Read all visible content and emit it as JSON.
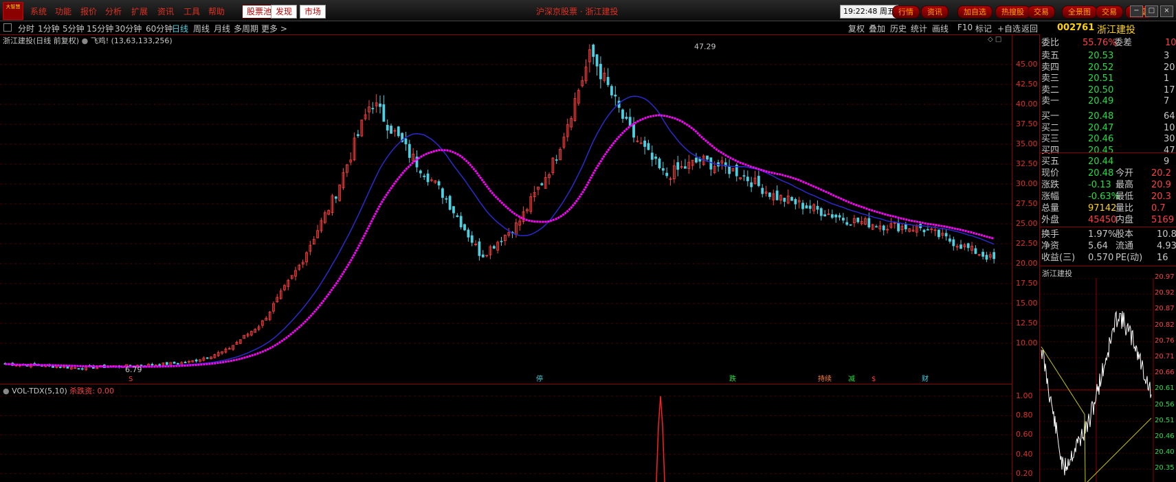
{
  "colors": {
    "up": "#ff4040",
    "down": "#4dd0e1",
    "ma": "#2a2ad0",
    "magenta": "#ff00ff",
    "grid": "#8b0000"
  },
  "menubar": {
    "logo": "大智慧",
    "menu": [
      "系统",
      "功能",
      "报价",
      "分析",
      "扩展",
      "资讯",
      "工具",
      "帮助"
    ],
    "pills": [
      "股票池",
      "发现",
      "市场"
    ],
    "center_title": "沪深京股票 · 浙江建投",
    "time": "19:22:48",
    "weekday": "周五",
    "right_buttons": [
      "行情",
      "资讯",
      "加自选",
      "热搜股",
      "交易",
      "全景图",
      "交易",
      "个股"
    ],
    "win_buttons": [
      "−",
      "□",
      "×"
    ]
  },
  "toolbar": {
    "periods": [
      "分时",
      "1分钟",
      "5分钟",
      "15分钟",
      "30分钟",
      "60分钟",
      "日线",
      "周线",
      "月线",
      "多周期",
      "更多 >"
    ],
    "active": "日线",
    "right": [
      "复权",
      "叠加",
      "历史",
      "统计",
      "画线",
      "F10",
      "标记",
      "+自选",
      "返回"
    ]
  },
  "main_chart": {
    "title": "浙江建投(日线 前复权)",
    "indicator": "飞鸡!",
    "indicator_params": "(13,63,133,256)",
    "high_label": "47.29",
    "low_label": "6.79",
    "yaxis": [
      "45.00",
      "42.50",
      "40.00",
      "37.50",
      "35.00",
      "32.50",
      "30.00",
      "27.50",
      "25.00",
      "22.50",
      "20.00",
      "17.50",
      "15.00",
      "12.50",
      "10.00"
    ],
    "events": [
      {
        "label": "S",
        "color": "#ff4040"
      },
      {
        "label": "停",
        "color": "#4dd0e1"
      },
      {
        "label": "跌",
        "color": "#20e040"
      },
      {
        "label": "持续",
        "color": "#ff8040"
      },
      {
        "label": "减",
        "color": "#20e040"
      },
      {
        "label": "$",
        "color": "#ff4040"
      },
      {
        "label": "财",
        "color": "#4dd0e1"
      }
    ]
  },
  "vol_chart": {
    "title": "VOL-TDX(5,10)",
    "extra_label": "杀跌资:",
    "extra_value": "0.00",
    "yaxis": [
      "1.00",
      "0.80",
      "0.60",
      "0.40",
      "0.20"
    ]
  },
  "quote": {
    "code": "002761",
    "name": "浙江建投",
    "weibi_label": "委比",
    "weibi": "55.76%",
    "weicha_label": "委差",
    "weicha": "10",
    "asks": [
      {
        "label": "卖五",
        "price": "20.53",
        "vol": "3"
      },
      {
        "label": "卖四",
        "price": "20.52",
        "vol": "20"
      },
      {
        "label": "卖三",
        "price": "20.51",
        "vol": "1"
      },
      {
        "label": "卖二",
        "price": "20.50",
        "vol": "17"
      },
      {
        "label": "卖一",
        "price": "20.49",
        "vol": "7"
      }
    ],
    "bids": [
      {
        "label": "买一",
        "price": "20.48",
        "vol": "64"
      },
      {
        "label": "买二",
        "price": "20.47",
        "vol": "10"
      },
      {
        "label": "买三",
        "price": "20.46",
        "vol": "30"
      },
      {
        "label": "买四",
        "price": "20.45",
        "vol": "47"
      },
      {
        "label": "买五",
        "price": "20.44",
        "vol": "9"
      }
    ],
    "stats": [
      {
        "l1": "现价",
        "v1": "20.48",
        "c1": "#20e040",
        "l2": "今开",
        "v2": "20.2"
      },
      {
        "l1": "涨跌",
        "v1": "-0.13",
        "c1": "#20e040",
        "l2": "最高",
        "v2": "20.9"
      },
      {
        "l1": "涨幅",
        "v1": "-0.63%",
        "c1": "#20e040",
        "l2": "最低",
        "v2": "20.3"
      },
      {
        "l1": "总量",
        "v1": "97142",
        "c1": "#ffd400",
        "l2": "量比",
        "v2": "0.7"
      },
      {
        "l1": "外盘",
        "v1": "45450",
        "c1": "#ff4040",
        "l2": "内盘",
        "v2": "5169"
      }
    ],
    "stats2": [
      {
        "l1": "换手",
        "v1": "1.97%",
        "l2": "股本",
        "v2": "10.8"
      },
      {
        "l1": "净资",
        "v1": "5.64",
        "l2": "流通",
        "v2": "4.93"
      },
      {
        "l1": "收益(三)",
        "v1": "0.570",
        "l2": "PE(动)",
        "v2": "16"
      }
    ]
  },
  "mini_chart": {
    "title": "浙江建投",
    "yaxis": [
      "20.97",
      "20.92",
      "20.87",
      "20.82",
      "20.76",
      "20.71",
      "20.66",
      "20.61",
      "20.56",
      "20.51",
      "20.46",
      "20.40",
      "20.35"
    ]
  },
  "chart_data": {
    "type": "line",
    "description_series": "daily close (approx)",
    "series": [
      {
        "name": "飞鸡!",
        "values": [
          7.4,
          7.2,
          6.9,
          7.1,
          7.3,
          7.6,
          9.0,
          12.5,
          19.5,
          28.5,
          40.5,
          34,
          28.5,
          21,
          25,
          33,
          46.5,
          37,
          31,
          33,
          31.5,
          28.5,
          27,
          25.5,
          24.8,
          24.5,
          22.5,
          20.5
        ]
      }
    ],
    "ylim": [
      5,
      47.5
    ]
  }
}
